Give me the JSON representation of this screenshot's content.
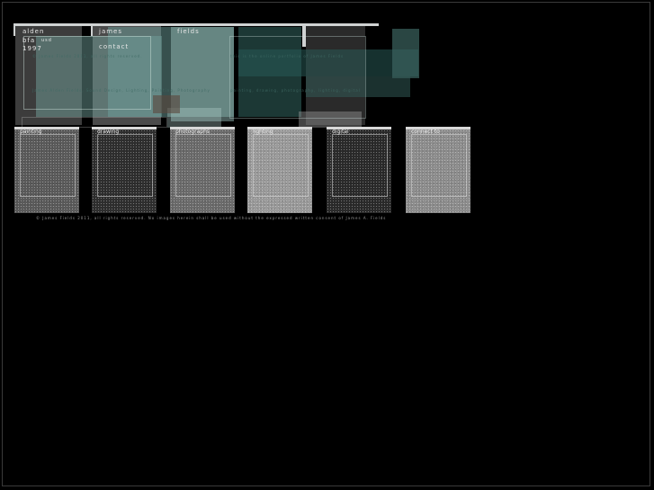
{
  "header": {
    "name_first": "alden",
    "name_middle": "james",
    "name_last": "fields",
    "degree": "bfa",
    "school": "usd",
    "year": "1997",
    "contact_label": "contact",
    "faint_line_1": "© James Fields 2011, all rights reserved.",
    "faint_line_2": "this is the online portfolio of James Fields",
    "faint_block_left": "James Alden Fields, Sound Design, Lighting, Painting, Photography",
    "faint_block_right": "painting, drawing, photography, lighting, digital"
  },
  "nav": {
    "tiles": [
      {
        "label": "painting",
        "tone": "#5a5a5a"
      },
      {
        "label": "drawing",
        "tone": "#2e2e2e"
      },
      {
        "label": "photographs",
        "tone": "#6b6b6b"
      },
      {
        "label": "lighting",
        "tone": "#9a9a9a"
      },
      {
        "label": "digital",
        "tone": "#2a2a2a"
      },
      {
        "label": "connect to",
        "tone": "#8d8d8d"
      }
    ]
  },
  "footer": {
    "copyright": "© James Fields 2011, all rights reserved. No images herein shall be used without the expressed written consent of James A. Fields"
  }
}
